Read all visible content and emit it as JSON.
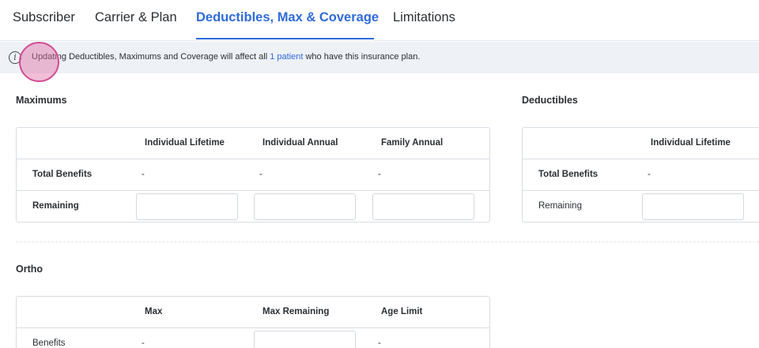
{
  "tabs": [
    {
      "label": "Subscriber"
    },
    {
      "label": "Carrier & Plan"
    },
    {
      "label": "Deductibles, Max & Coverage"
    },
    {
      "label": "Limitations"
    }
  ],
  "banner": {
    "text_before": "Updating Deductibles, Maximums and Coverage will affect all ",
    "link": "1 patient",
    "text_after": " who have this insurance plan."
  },
  "maximums": {
    "title": "Maximums",
    "columns": [
      "Individual Lifetime",
      "Individual Annual",
      "Family Annual"
    ],
    "total_benefits": {
      "label": "Total Benefits",
      "values": [
        "-",
        "-",
        "-"
      ]
    },
    "remaining": {
      "label": "Remaining"
    }
  },
  "deductibles": {
    "title": "Deductibles",
    "columns": [
      "Individual Lifetime"
    ],
    "total_benefits": {
      "label": "Total Benefits",
      "values": [
        "-"
      ]
    },
    "remaining": {
      "label": "Remaining"
    }
  },
  "ortho": {
    "title": "Ortho",
    "columns": [
      "Max",
      "Max Remaining",
      "Age Limit"
    ],
    "benefits": {
      "label": "Benefits",
      "max": "-",
      "age_limit": "-"
    }
  }
}
